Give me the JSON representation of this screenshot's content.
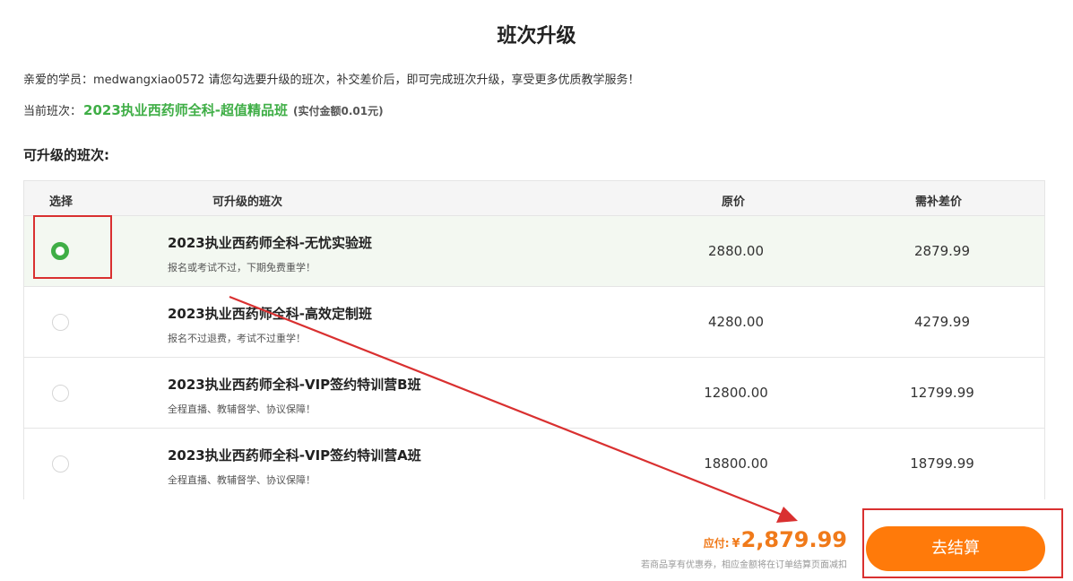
{
  "title": "班次升级",
  "greeting": "亲爱的学员：medwangxiao0572 请您勾选要升级的班次，补交差价后，即可完成班次升级，享受更多优质教学服务！",
  "current": {
    "label": "当前班次：",
    "course": "2023执业西药师全科-超值精品班",
    "paid": "(实付金额0.01元)"
  },
  "section_title": "可升级的班次:",
  "table": {
    "headers": {
      "select": "选择",
      "class": "可升级的班次",
      "original_price": "原价",
      "difference": "需补差价"
    },
    "rows": [
      {
        "name": "2023执业西药师全科-无忧实验班",
        "desc": "报名或考试不过，下期免费重学！",
        "original": "2880.00",
        "diff": "2879.99",
        "selected": true
      },
      {
        "name": "2023执业西药师全科-高效定制班",
        "desc": "报名不过退费，考试不过重学！",
        "original": "4280.00",
        "diff": "4279.99",
        "selected": false
      },
      {
        "name": "2023执业西药师全科-VIP签约特训营B班",
        "desc": "全程直播、教辅督学、协议保障！",
        "original": "12800.00",
        "diff": "12799.99",
        "selected": false
      },
      {
        "name": "2023执业西药师全科-VIP签约特训营A班",
        "desc": "全程直播、教辅督学、协议保障！",
        "original": "18800.00",
        "diff": "18799.99",
        "selected": false
      }
    ]
  },
  "payment": {
    "label": "应付:",
    "currency": "¥",
    "amount": "2,879.99",
    "note": "若商品享有优惠券，相应金额将在订单结算页面减扣"
  },
  "checkout_label": "去结算",
  "colors": {
    "accent_green": "#3fae46",
    "accent_orange": "#ff7a0a",
    "annotation_red": "#d93030"
  }
}
